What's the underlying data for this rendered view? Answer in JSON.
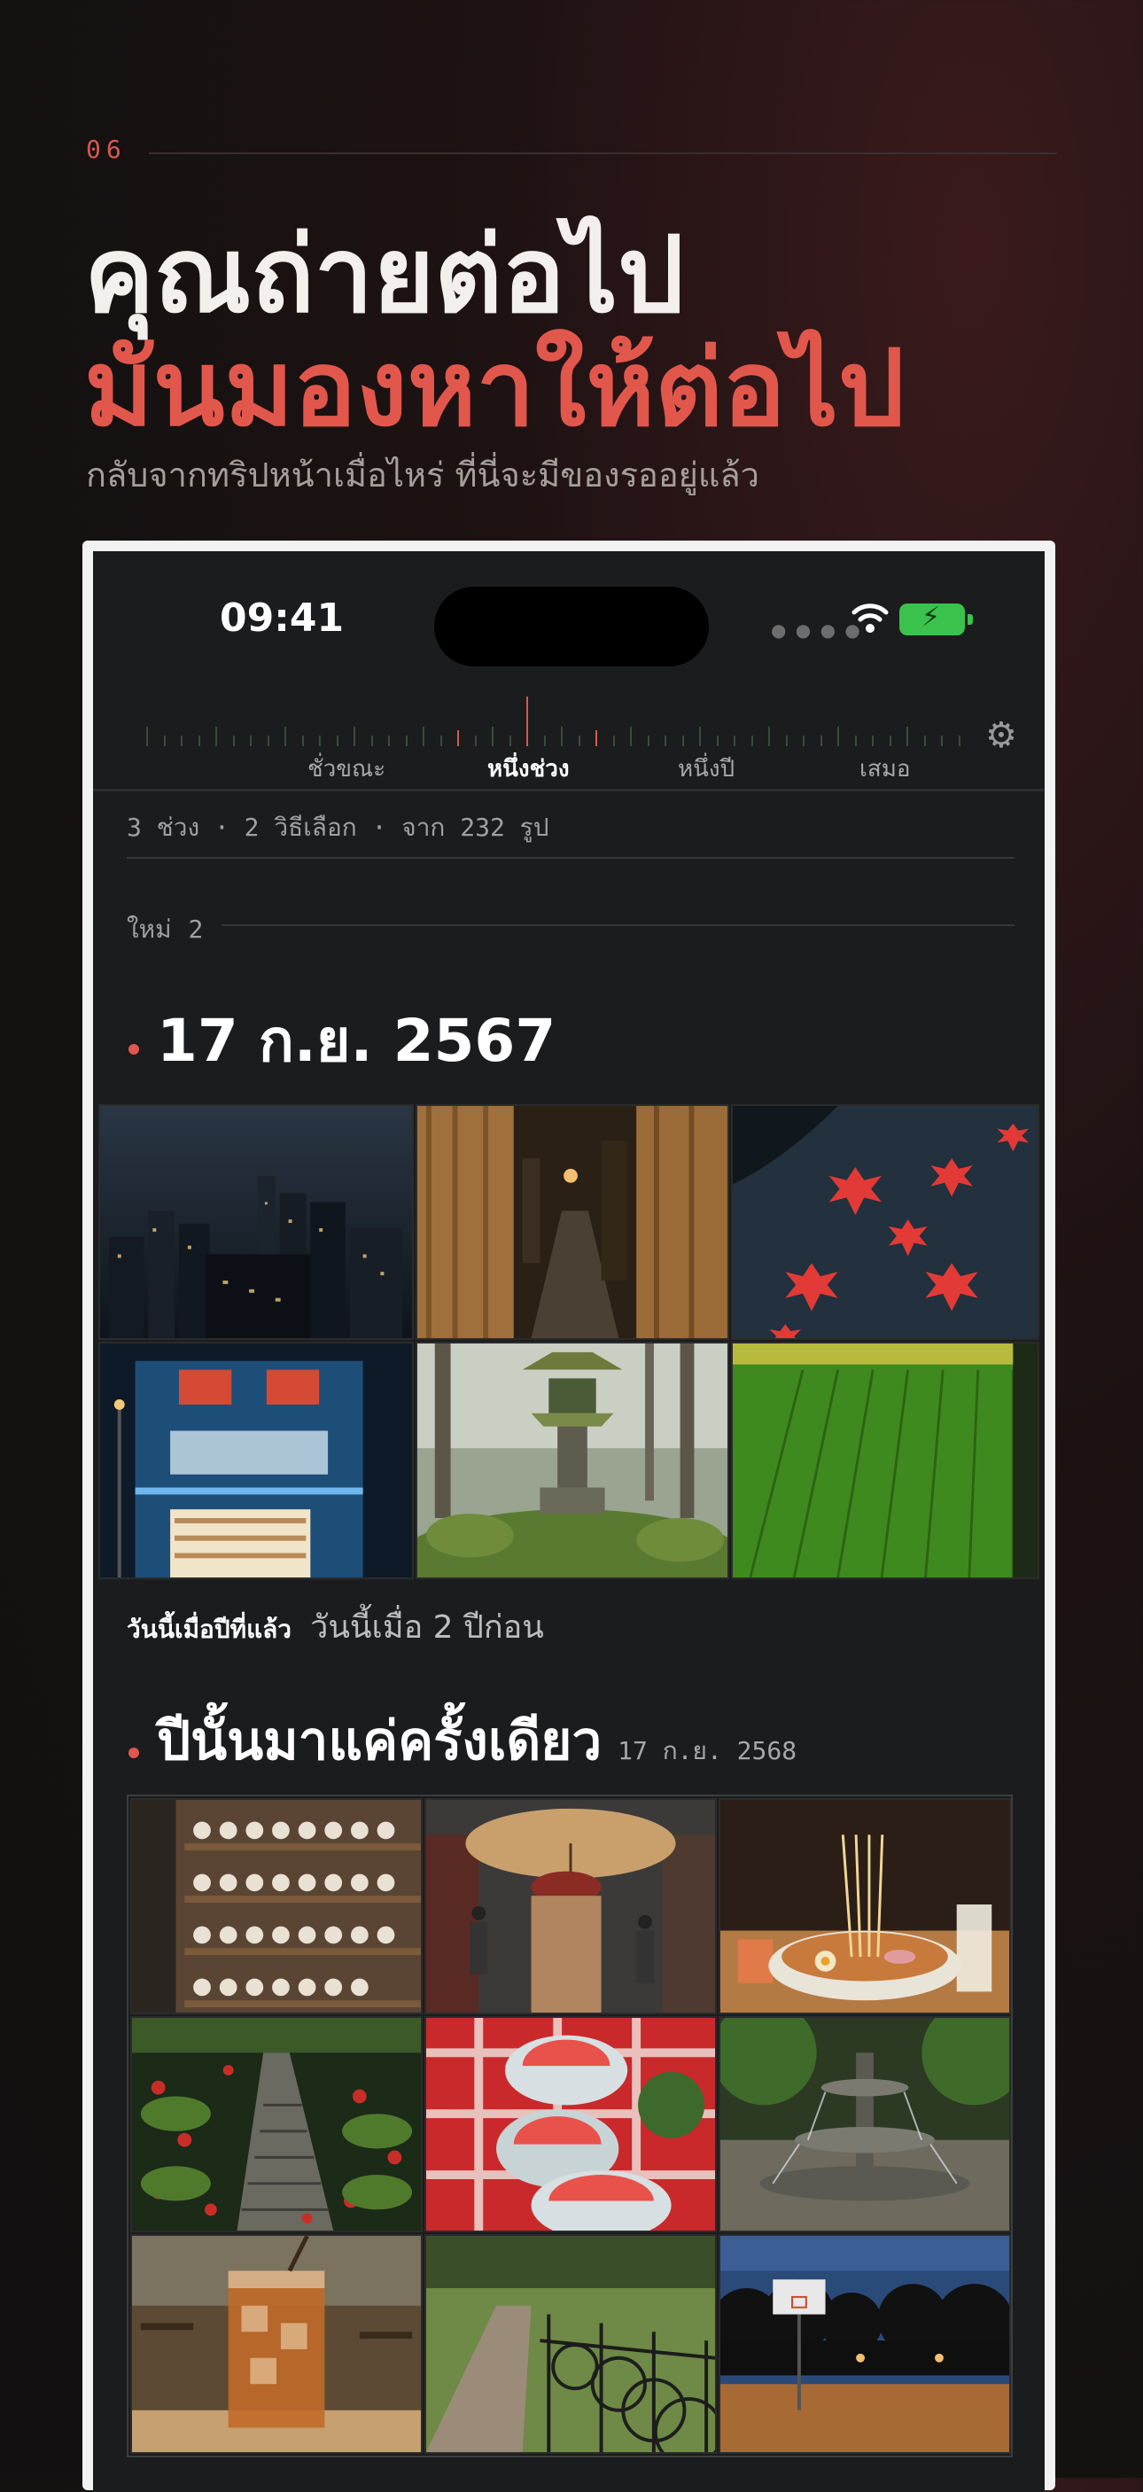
{
  "page": {
    "step_number": "06",
    "headline_line1": "คุณถ่ายต่อไป",
    "headline_line2": "มันมองหาให้ต่อไป",
    "subtitle": "กลับจากทริปหน้าเมื่อไหร่ ที่นี่จะมีของรออยู่แล้ว"
  },
  "status_bar": {
    "time": "09:41",
    "battery": "charging"
  },
  "timeline": {
    "segments": [
      "ชั่วขณะ",
      "หนึ่งช่วง",
      "หนึ่งปี",
      "เสมอ"
    ],
    "active_segment": "หนึ่งช่วง",
    "settings_icon": "gear-icon"
  },
  "summary": {
    "text": "3 ช่วง · 2 วิธีเลือก · จาก 232 รูป"
  },
  "new_section": {
    "label": "ใหม่",
    "count": "2"
  },
  "moment1": {
    "date": "17 ก.ย. 2567",
    "photos": [
      "rainy-city-skyline-night",
      "narrow-alley-curtains-lantern",
      "red-maple-leaves-dark-water",
      "blue-convenience-store-night",
      "moss-stone-lantern-forest",
      "green-rice-field-rows"
    ]
  },
  "caption": {
    "kind": "วันนี้เมื่อปีที่แล้ว",
    "relative": "วันนี้เมื่อ 2 ปีก่อน"
  },
  "moment2": {
    "title": "ปีนั้นมาแค่ครั้งเดียว",
    "date": "17 ก.ย. 2568",
    "photos": [
      "ceramic-cups-shelves",
      "person-with-paper-umbrella-street",
      "ramen-bowl-noodles",
      "stone-path-red-leaves-moss",
      "watermelon-slices-picnic",
      "park-fountain",
      "iced-tea-cafe",
      "bicycles-along-fence",
      "basketball-court-dusk"
    ]
  },
  "colors": {
    "accent": "#e2574c",
    "background": "#141111",
    "screen": "#1b1c1e",
    "battery": "#3bc24c"
  }
}
